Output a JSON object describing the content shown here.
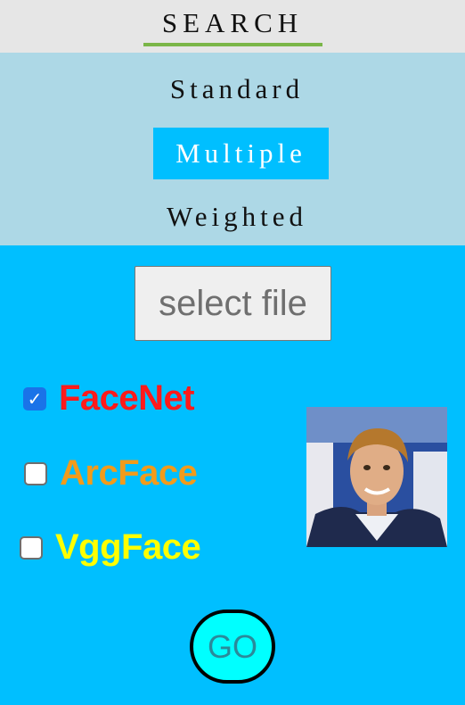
{
  "header": {
    "title": "SEARCH"
  },
  "modes": {
    "standard": "Standard",
    "multiple": "Multiple",
    "weighted": "Weighted",
    "selected": "Multiple"
  },
  "file_input": {
    "label": "select file"
  },
  "models": [
    {
      "name": "FaceNet",
      "checked": true,
      "color": "#ff1a1a"
    },
    {
      "name": "ArcFace",
      "checked": false,
      "color": "#f29b1b"
    },
    {
      "name": "VggFace",
      "checked": false,
      "color": "#ffff00"
    }
  ],
  "photo": {
    "description_icon": "face-photo"
  },
  "go_button": {
    "label": "GO"
  },
  "colors": {
    "header_bg": "#e6e6e6",
    "header_underline": "#7ab648",
    "modes_bg": "#add8e6",
    "main_bg": "#00bfff",
    "go_bg": "#00ffff"
  }
}
